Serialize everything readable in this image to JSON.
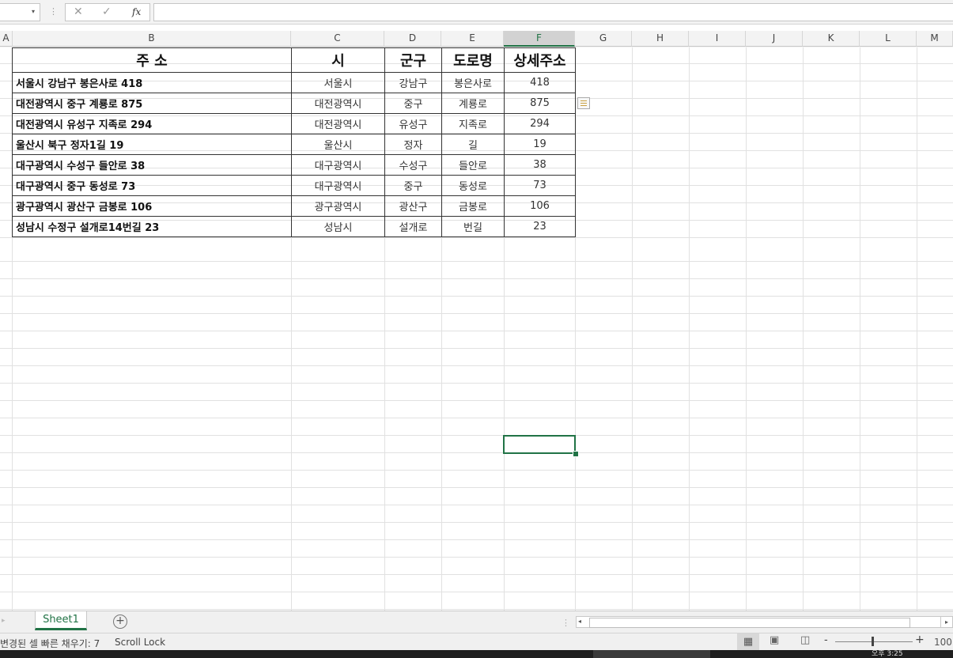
{
  "formula_bar": {
    "name_box_value": "",
    "name_box_arrow": "▾",
    "separator": "⋮",
    "cancel_icon": "✕",
    "enter_icon": "✓",
    "function_icon": "fx",
    "formula_value": ""
  },
  "columns": [
    "A",
    "B",
    "C",
    "D",
    "E",
    "F",
    "G",
    "H",
    "I",
    "J",
    "K",
    "L",
    "M"
  ],
  "selected_column": "F",
  "table": {
    "headers": [
      "주 소",
      "시",
      "군구",
      "도로명",
      "상세주소"
    ],
    "rows": [
      [
        "서울시 강남구 봉은사로 418",
        "서울시",
        "강남구",
        "봉은사로",
        "418"
      ],
      [
        "대전광역시 중구 계룡로 875",
        "대전광역시",
        "중구",
        "계룡로",
        "875"
      ],
      [
        "대전광역시 유성구 지족로 294",
        "대전광역시",
        "유성구",
        "지족로",
        "294"
      ],
      [
        "울산시 북구 정자1길 19",
        "울산시",
        "정자",
        "길",
        "19"
      ],
      [
        "대구광역시 수성구 들안로 38",
        "대구광역시",
        "수성구",
        "들안로",
        "38"
      ],
      [
        "대구광역시 중구 동성로 73",
        "대구광역시",
        "중구",
        "동성로",
        "73"
      ],
      [
        "광구광역시 광산구 금봉로 106",
        "광구광역시",
        "광산구",
        "금봉로",
        "106"
      ],
      [
        "성남시 수정구 설개로14번길 23",
        "성남시",
        "설개로",
        "번길",
        "23"
      ]
    ]
  },
  "sheet_tabs": {
    "nav_arrow": "▸",
    "active": "Sheet1",
    "add_icon": "+"
  },
  "status_bar": {
    "fill_text": "변경된 셀 빠른 채우기: 7",
    "scroll_lock": "Scroll Lock",
    "zoom_minus": "-",
    "zoom_plus": "+",
    "zoom_level": "100",
    "view_normal_icon": "▦",
    "view_layout_icon": "▣",
    "view_pagebreak_icon": "◫"
  },
  "horizontal_scrollbar": {
    "left_arrow": "◂",
    "right_arrow": "▸",
    "split_handle": "⋮"
  },
  "taskbar": {
    "clock": "오후 3:25"
  },
  "colors": {
    "accent": "#217346",
    "gridline": "#e1e1e1",
    "header_bg": "#f3f3f3"
  }
}
